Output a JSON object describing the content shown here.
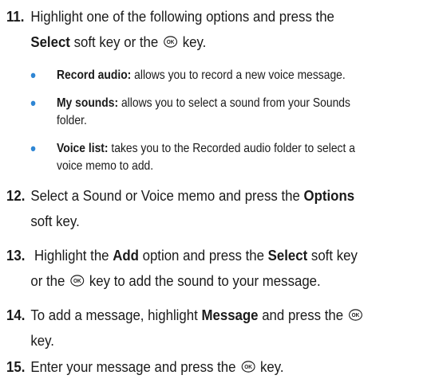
{
  "steps": [
    {
      "num": "11.",
      "line1_pre": "Highlight one of the following options and press the",
      "line2_b": "Select",
      "line2_mid": " soft key or the ",
      "line2_post": " key."
    }
  ],
  "options": [
    {
      "label": "Record audio:",
      "text1": " allows you to record a new voice message.",
      "text2": ""
    },
    {
      "label": "My sounds:",
      "text1": " allows you to select a sound from your Sounds",
      "text2": "folder."
    },
    {
      "label": "Voice list:",
      "text1": " takes you to the Recorded audio folder to select a",
      "text2": "voice memo to add."
    }
  ],
  "step12": {
    "num": "12.",
    "pre": "Select a Sound or Voice memo and press the ",
    "b": "Options",
    "line2": "soft key."
  },
  "step13": {
    "num": "13.",
    "pre": " Highlight the ",
    "b1": "Add",
    "mid": " option and press the ",
    "b2": "Select",
    "post": " soft key",
    "line2_pre": "or the ",
    "line2_post": " key to add the sound to your message."
  },
  "step14": {
    "num": "14.",
    "pre": "To add a message, highlight ",
    "b": "Message",
    "mid": " and press the ",
    "line2": "key."
  },
  "step15": {
    "num": "15.",
    "pre": "Enter your message and press the ",
    "post": " key."
  },
  "ok_key": {
    "glyph": "OK",
    "icon": "ok-key-icon"
  },
  "colors": {
    "bullet": "#2f86d4",
    "text": "#1a1a1a"
  }
}
